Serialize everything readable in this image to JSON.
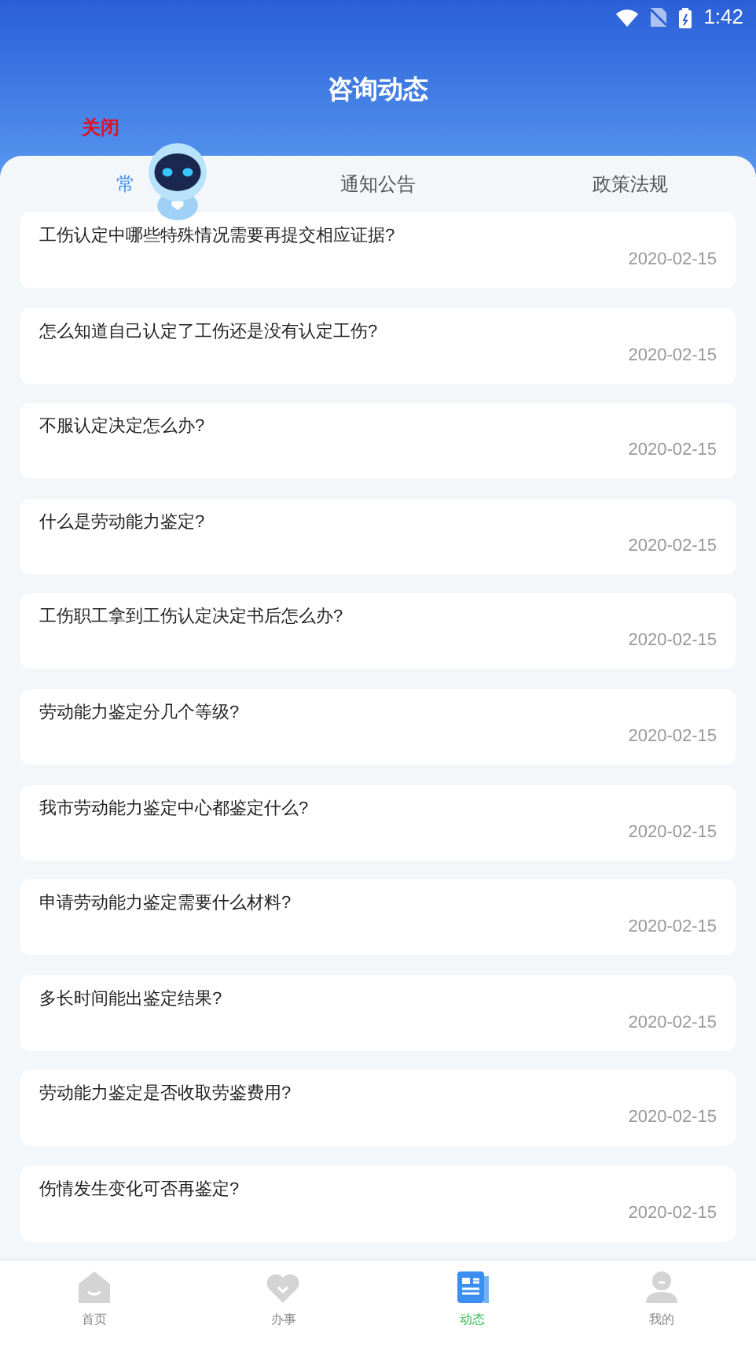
{
  "status_bar": {
    "time": "1:42"
  },
  "header": {
    "title": "咨询动态"
  },
  "assistant": {
    "close_label": "关闭"
  },
  "tabs": [
    {
      "label": "常",
      "selected": true
    },
    {
      "label": "通知公告",
      "selected": false
    },
    {
      "label": "政策法规",
      "selected": false
    }
  ],
  "articles": [
    {
      "title": "工伤认定中哪些特殊情况需要再提交相应证据?",
      "date": "2020-02-15"
    },
    {
      "title": "怎么知道自己认定了工伤还是没有认定工伤?",
      "date": "2020-02-15"
    },
    {
      "title": "不服认定决定怎么办?",
      "date": "2020-02-15"
    },
    {
      "title": "什么是劳动能力鉴定?",
      "date": "2020-02-15"
    },
    {
      "title": "工伤职工拿到工伤认定决定书后怎么办?",
      "date": "2020-02-15"
    },
    {
      "title": "劳动能力鉴定分几个等级?",
      "date": "2020-02-15"
    },
    {
      "title": "我市劳动能力鉴定中心都鉴定什么?",
      "date": "2020-02-15"
    },
    {
      "title": "申请劳动能力鉴定需要什么材料?",
      "date": "2020-02-15"
    },
    {
      "title": "多长时间能出鉴定结果?",
      "date": "2020-02-15"
    },
    {
      "title": "劳动能力鉴定是否收取劳鉴费用?",
      "date": "2020-02-15"
    },
    {
      "title": "伤情发生变化可否再鉴定?",
      "date": "2020-02-15"
    }
  ],
  "bottom_nav": [
    {
      "kind": "home",
      "label": "首页",
      "selected": false
    },
    {
      "kind": "heart",
      "label": "办事",
      "selected": false
    },
    {
      "kind": "news",
      "label": "动态",
      "selected": true
    },
    {
      "kind": "person",
      "label": "我的",
      "selected": false
    }
  ]
}
